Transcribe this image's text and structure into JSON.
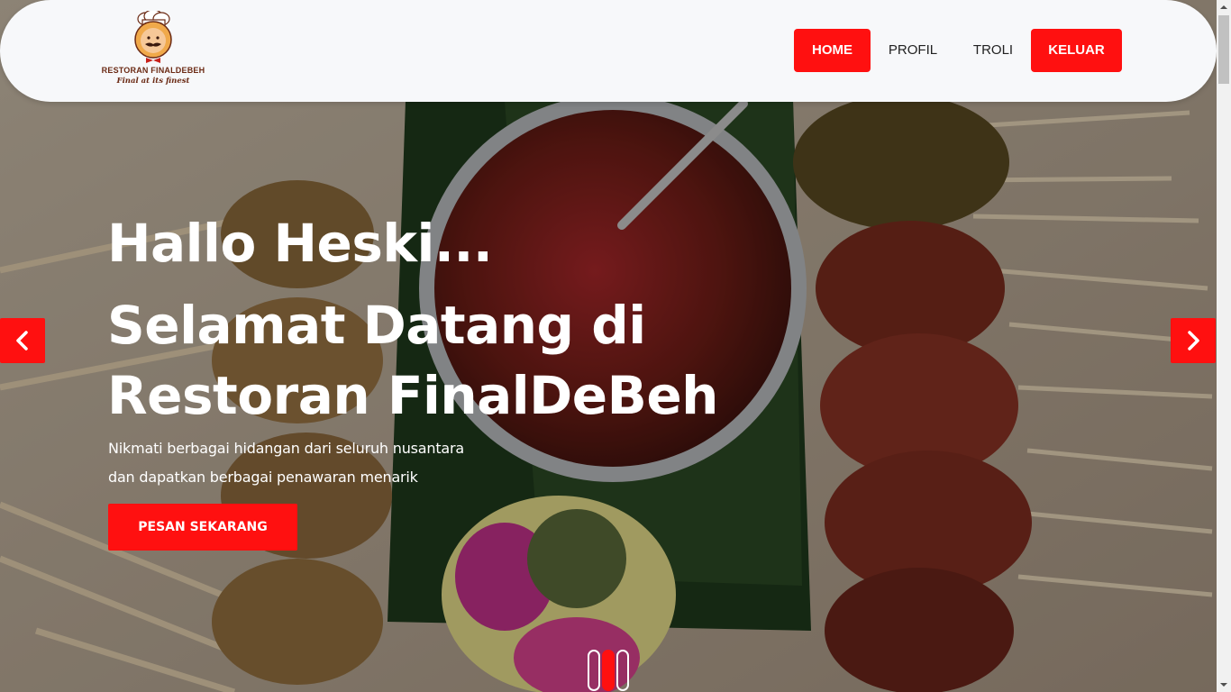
{
  "brand": {
    "name": "RESTORAN FINALDEBEH",
    "tagline": "Final at its finest"
  },
  "nav": {
    "home": "HOME",
    "profil": "PROFIL",
    "troli": "TROLI",
    "keluar": "KELUAR"
  },
  "hero": {
    "greeting": "Hallo Heski...",
    "headline": "Selamat Datang di Restoran FinalDeBeh",
    "subtitle_line1": "Nikmati berbagai hidangan dari seluruh nusantara",
    "subtitle_line2": "dan dapatkan berbagai penawaran menarik",
    "cta_label": "PESAN SEKARANG"
  },
  "carousel": {
    "slides": 3,
    "active_slide": 2
  },
  "icons": {
    "prev": "chevron-left-icon",
    "next": "chevron-right-icon",
    "logo": "chef-logo"
  },
  "colors": {
    "accent": "#ff1010",
    "navbar_bg": "#f7f8fa",
    "text_dark": "#222222",
    "logo_brown": "#6b2a14"
  }
}
